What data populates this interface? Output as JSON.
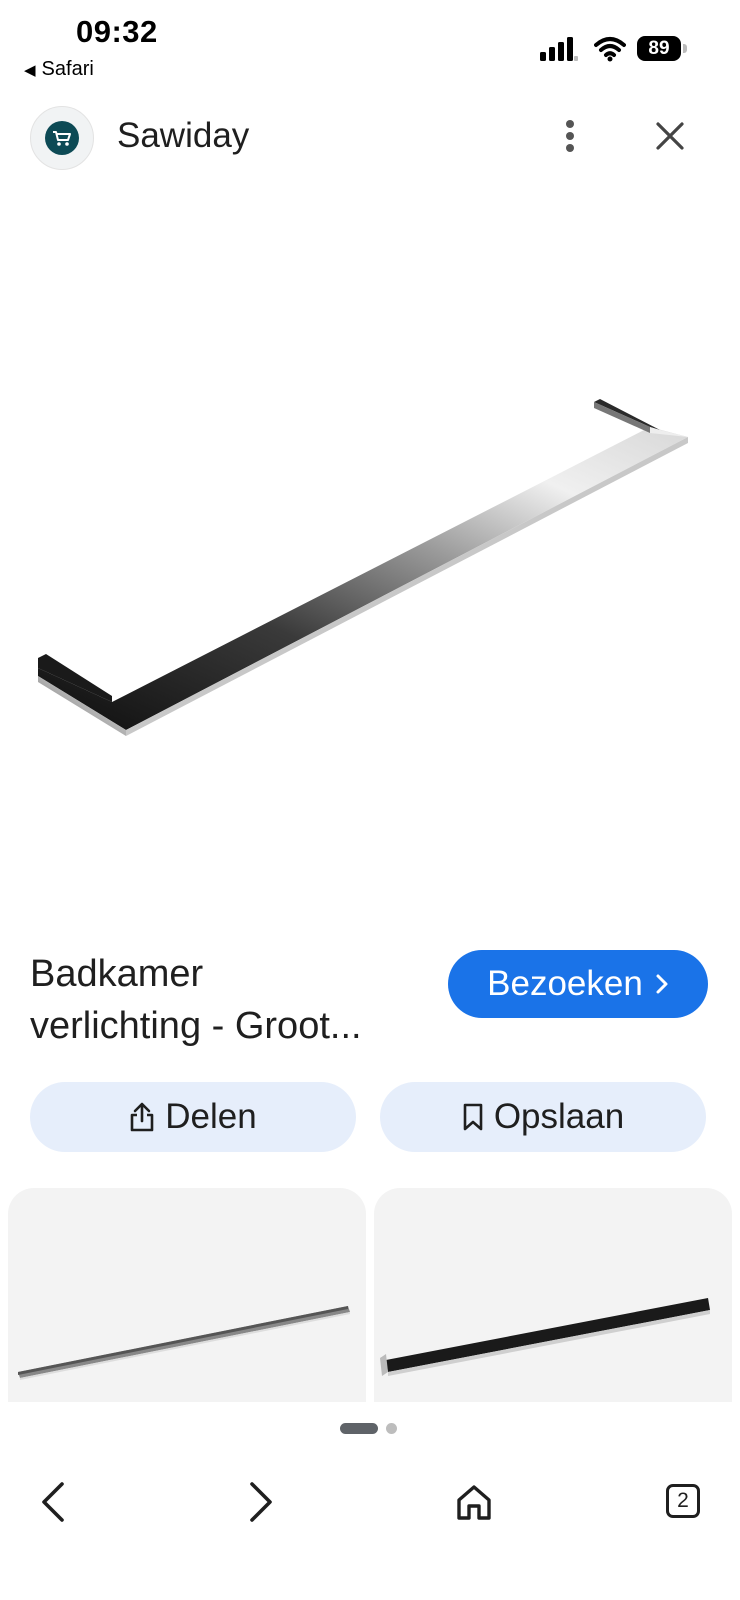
{
  "status_bar": {
    "time": "09:32",
    "back_app": "Safari",
    "battery": "89"
  },
  "header": {
    "site_name": "Sawiday",
    "icons": [
      "cart-logo-icon",
      "more-vert-icon",
      "close-icon"
    ]
  },
  "result": {
    "title_line1": "Badkamer",
    "title_line2": "verlichting - Groot...",
    "visit_label": "Bezoeken",
    "visit_color": "#1a73e8"
  },
  "actions": {
    "share_label": "Delen",
    "save_label": "Opslaan",
    "pill_color": "#e6eefb"
  },
  "carousel": {
    "pages": 2,
    "active": 1
  },
  "bottom_nav": {
    "tab_count": "2",
    "icons": [
      "back-icon",
      "forward-icon",
      "home-icon",
      "tabs-icon"
    ]
  }
}
